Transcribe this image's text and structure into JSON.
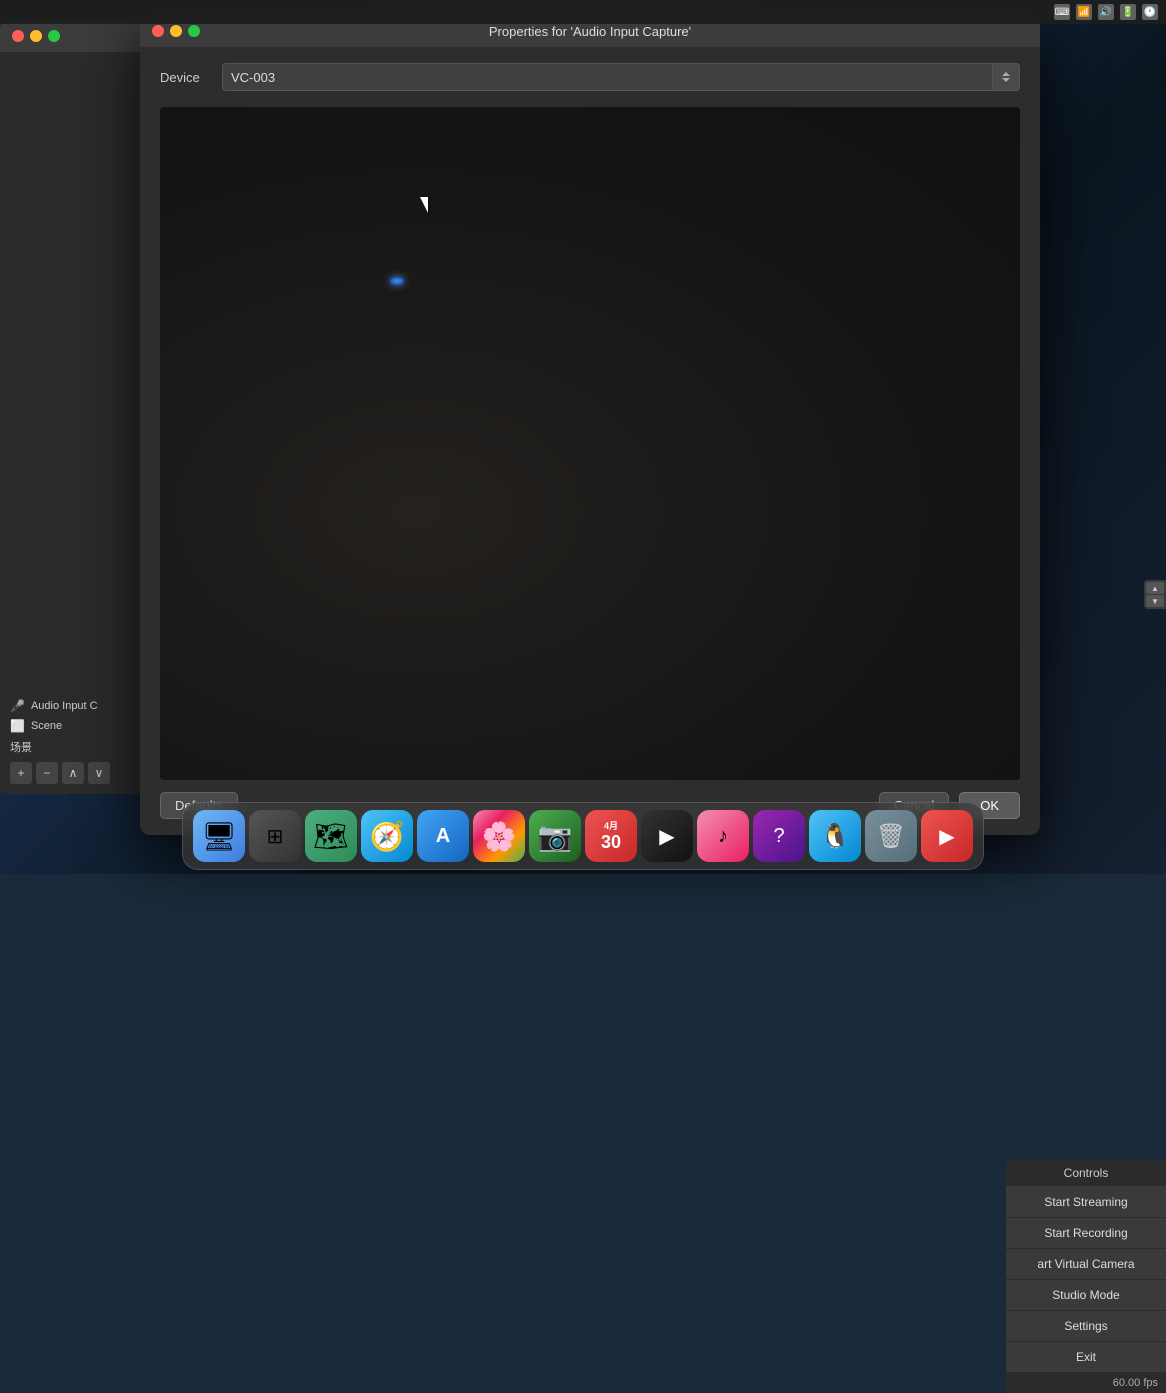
{
  "desktop": {
    "background": "dark blue gradient"
  },
  "dialog": {
    "title": "Properties for 'Audio Input Capture'",
    "device_label": "Device",
    "device_value": "VC-003",
    "defaults_btn": "Defaults",
    "cancel_btn": "Cancel",
    "ok_btn": "OK"
  },
  "obs_controls": {
    "header": "Controls",
    "start_streaming": "Start Streaming",
    "start_recording": "Start Recording",
    "start_virtual_camera": "art Virtual Camera",
    "studio_mode": "Studio Mode",
    "settings": "Settings",
    "exit": "Exit",
    "fps": "60.00 fps"
  },
  "obs_sources": {
    "audio_input": "Audio Input C",
    "scene_label": "Scene",
    "scene_chinese": "场景"
  },
  "dock": {
    "apps": [
      {
        "name": "Finder",
        "icon": "🖥"
      },
      {
        "name": "Launchpad",
        "icon": "⊞"
      },
      {
        "name": "Maps",
        "icon": "🗺"
      },
      {
        "name": "Safari",
        "icon": "🧭"
      },
      {
        "name": "App Store",
        "icon": "Ａ"
      },
      {
        "name": "Photos",
        "icon": "🌸"
      },
      {
        "name": "FaceTime",
        "icon": "📷"
      },
      {
        "name": "Calendar",
        "icon": "📅"
      },
      {
        "name": "Apple TV",
        "icon": "▶"
      },
      {
        "name": "Music",
        "icon": "♪"
      },
      {
        "name": "Unknown",
        "icon": "?"
      },
      {
        "name": "QQ",
        "icon": "🐧"
      },
      {
        "name": "Trash",
        "icon": "🗑"
      },
      {
        "name": "YouTube",
        "icon": "▶"
      }
    ]
  }
}
